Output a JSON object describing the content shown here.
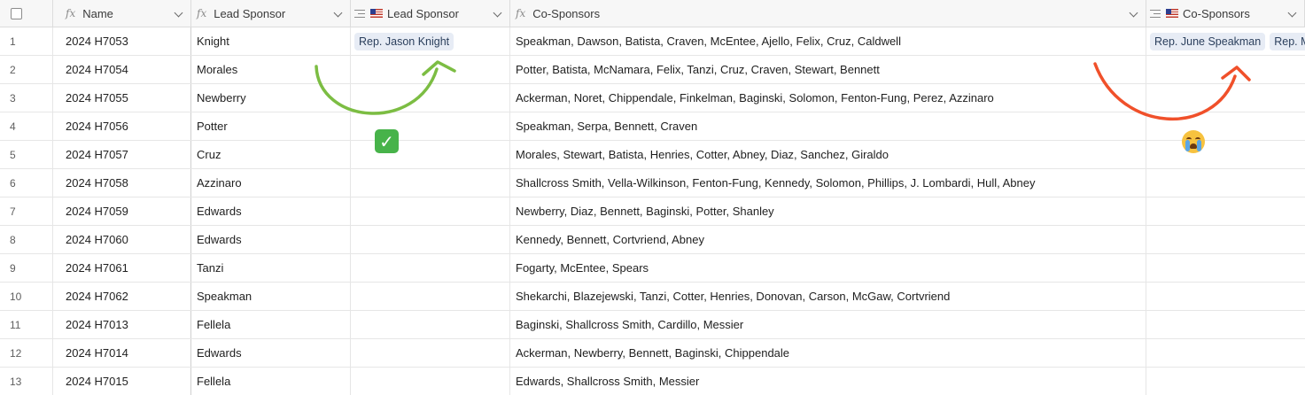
{
  "columns": {
    "name": "Name",
    "lead_sponsor": "Lead Sponsor",
    "lead_sponsor_linked": "Lead Sponsor",
    "co_sponsors": "Co-Sponsors",
    "co_sponsors_linked": "Co-Sponsors"
  },
  "rows": [
    {
      "num": "1",
      "name": "2024 H7053",
      "lead": "Knight",
      "lead_linked": [
        "Rep. Jason Knight"
      ],
      "co": "Speakman, Dawson, Batista, Craven, McEntee, Ajello, Felix, Cruz, Caldwell",
      "co_linked": [
        "Rep. June Speakman",
        "Rep. M"
      ]
    },
    {
      "num": "2",
      "name": "2024 H7054",
      "lead": "Morales",
      "lead_linked": [],
      "co": "Potter, Batista, McNamara, Felix, Tanzi, Cruz, Craven, Stewart, Bennett",
      "co_linked": []
    },
    {
      "num": "3",
      "name": "2024 H7055",
      "lead": "Newberry",
      "lead_linked": [],
      "co": "Ackerman, Noret, Chippendale, Finkelman, Baginski, Solomon, Fenton-Fung, Perez, Azzinaro",
      "co_linked": []
    },
    {
      "num": "4",
      "name": "2024 H7056",
      "lead": "Potter",
      "lead_linked": [],
      "co": "Speakman, Serpa, Bennett, Craven",
      "co_linked": []
    },
    {
      "num": "5",
      "name": "2024 H7057",
      "lead": "Cruz",
      "lead_linked": [],
      "co": "Morales, Stewart, Batista, Henries, Cotter, Abney, Diaz, Sanchez, Giraldo",
      "co_linked": []
    },
    {
      "num": "6",
      "name": "2024 H7058",
      "lead": "Azzinaro",
      "lead_linked": [],
      "co": "Shallcross Smith, Vella-Wilkinson, Fenton-Fung, Kennedy, Solomon, Phillips, J. Lombardi, Hull, Abney",
      "co_linked": []
    },
    {
      "num": "7",
      "name": "2024 H7059",
      "lead": "Edwards",
      "lead_linked": [],
      "co": "Newberry, Diaz, Bennett, Baginski, Potter, Shanley",
      "co_linked": []
    },
    {
      "num": "8",
      "name": "2024 H7060",
      "lead": "Edwards",
      "lead_linked": [],
      "co": "Kennedy, Bennett, Cortvriend, Abney",
      "co_linked": []
    },
    {
      "num": "9",
      "name": "2024 H7061",
      "lead": "Tanzi",
      "lead_linked": [],
      "co": "Fogarty, McEntee, Spears",
      "co_linked": []
    },
    {
      "num": "10",
      "name": "2024 H7062",
      "lead": "Speakman",
      "lead_linked": [],
      "co": "Shekarchi, Blazejewski, Tanzi, Cotter, Henries, Donovan, Carson, McGaw, Cortvriend",
      "co_linked": []
    },
    {
      "num": "11",
      "name": "2024 H7013",
      "lead": "Fellela",
      "lead_linked": [],
      "co": "Baginski, Shallcross Smith, Cardillo, Messier",
      "co_linked": []
    },
    {
      "num": "12",
      "name": "2024 H7014",
      "lead": "Edwards",
      "lead_linked": [],
      "co": "Ackerman, Newberry, Bennett, Baginski, Chippendale",
      "co_linked": []
    },
    {
      "num": "13",
      "name": "2024 H7015",
      "lead": "Fellela",
      "lead_linked": [],
      "co": "Edwards, Shallcross Smith, Messier",
      "co_linked": []
    }
  ],
  "annotations": {
    "green_arrow_color": "#7cbd43",
    "red_arrow_color": "#f0502a",
    "success_emoji": "white-heavy-check-mark",
    "fail_emoji": "loudly-crying-face"
  }
}
